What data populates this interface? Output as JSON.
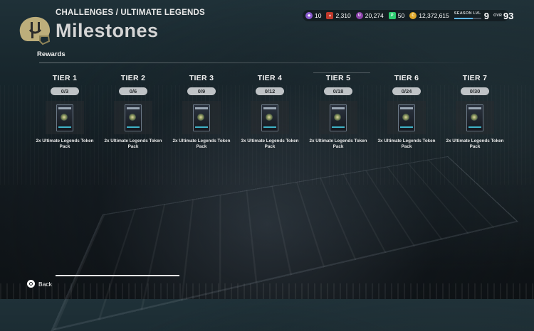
{
  "header": {
    "breadcrumb": "CHALLENGES / ULTIMATE LEGENDS",
    "title": "Milestones",
    "logo_icon": "helmet-logo-icon"
  },
  "section_label": "Rewards",
  "hud": {
    "currencies": [
      {
        "icon": "purple-token-icon",
        "value": "10",
        "color": "#8a5bd0"
      },
      {
        "icon": "red-token-icon",
        "value": "2,310",
        "color": "#c0392b"
      },
      {
        "icon": "ut-token-icon",
        "value": "20,274",
        "color": "#8e44ad"
      },
      {
        "icon": "green-token-icon",
        "value": "50",
        "color": "#2ecc71"
      },
      {
        "icon": "coins-icon",
        "value": "12,372,615",
        "color": "#e0a92a"
      }
    ],
    "season_label": "SEASON LVL",
    "season_level": "9",
    "season_progress": 0.7,
    "ovr_label": "OVR",
    "ovr_value": "93"
  },
  "tiers": [
    {
      "title": "TIER 1",
      "progress": "0/3",
      "reward": "2x Ultimate Legends Token Pack"
    },
    {
      "title": "TIER 2",
      "progress": "0/6",
      "reward": "2x Ultimate Legends Token Pack"
    },
    {
      "title": "TIER 3",
      "progress": "0/9",
      "reward": "2x Ultimate Legends Token Pack"
    },
    {
      "title": "TIER 4",
      "progress": "0/12",
      "reward": "3x Ultimate Legends Token Pack"
    },
    {
      "title": "TIER 5",
      "progress": "0/18",
      "reward": "2x Ultimate Legends Token Pack"
    },
    {
      "title": "TIER 6",
      "progress": "0/24",
      "reward": "3x Ultimate Legends Token Pack"
    },
    {
      "title": "TIER 7",
      "progress": "0/30",
      "reward": "2x Ultimate Legends Token Pack"
    }
  ],
  "footer": {
    "back_label": "Back",
    "back_icon": "circle-button-icon"
  }
}
